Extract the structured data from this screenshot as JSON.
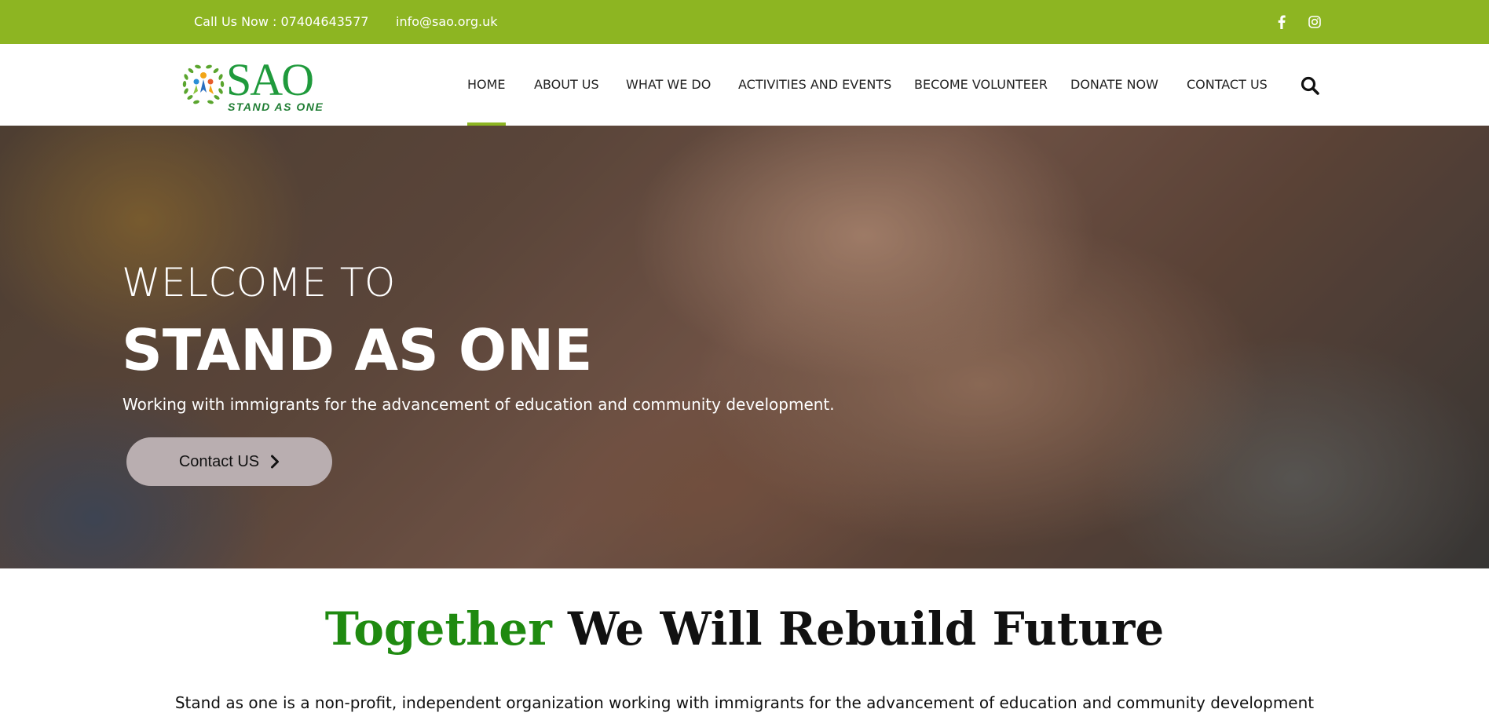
{
  "topbar": {
    "phone": "Call Us Now : 07404643577",
    "email": "info@sao.org.uk",
    "social": [
      {
        "icon": "facebook-icon"
      },
      {
        "icon": "instagram-icon"
      }
    ],
    "color": "#8db522"
  },
  "logo": {
    "text": "SAO",
    "tagline": "STAND AS ONE"
  },
  "nav": {
    "items": [
      {
        "label": "HOME",
        "active": true
      },
      {
        "label": "ABOUT US"
      },
      {
        "label": "WHAT WE DO"
      },
      {
        "label": "ACTIVITIES AND EVENTS"
      },
      {
        "label": "BECOME VOLUNTEER"
      },
      {
        "label": "DONATE NOW"
      },
      {
        "label": "CONTACT US"
      }
    ],
    "search_icon": "search-icon"
  },
  "hero": {
    "welcome": "WELCOME TO",
    "title": "STAND AS ONE",
    "subtitle": "Working with immigrants for the advancement of education and community development.",
    "button_label": "Contact US",
    "button_icon": "chevron-right-icon"
  },
  "section": {
    "headline_green": "Together",
    "headline_rest": " We Will Rebuild Future",
    "intro": "Stand as one is a non-profit, independent organization working with immigrants for the advancement of education and community development"
  },
  "colors": {
    "accent": "#8db522",
    "headline_green": "#1f8a10"
  }
}
